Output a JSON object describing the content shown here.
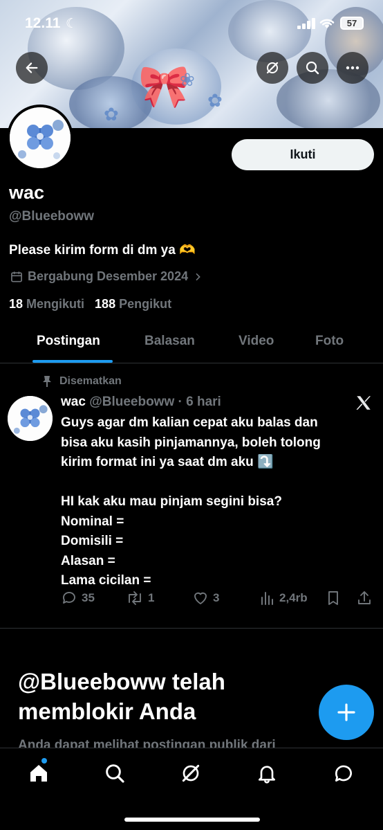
{
  "status_bar": {
    "time": "12.11",
    "battery": "57"
  },
  "profile": {
    "name": "wac",
    "handle": "@Blueeboww",
    "bio": "Please kirim form di dm ya 🫶",
    "joined": "Bergabung Desember 2024",
    "following_count": "18",
    "following_label": "Mengikuti",
    "followers_count": "188",
    "followers_label": "Pengikut",
    "follow_button": "Ikuti"
  },
  "tabs": [
    {
      "label": "Postingan",
      "active": true
    },
    {
      "label": "Balasan",
      "active": false
    },
    {
      "label": "Video",
      "active": false
    },
    {
      "label": "Foto",
      "active": false
    }
  ],
  "pinned_post": {
    "pinned_label": "Disematkan",
    "author_name": "wac",
    "author_meta": "@Blueeboww · 6 hari",
    "body_lines": [
      "Guys agar dm kalian cepat aku balas dan",
      "bisa aku kasih pinjamannya, boleh tolong",
      "kirim format ini ya saat dm aku ⤵️",
      "",
      "HI kak aku mau pinjam segini bisa?",
      "Nominal =",
      "Domisili =",
      "Alasan =",
      "Lama cicilan ="
    ],
    "replies": "35",
    "reposts": "1",
    "likes": "3",
    "views": "2,4rb"
  },
  "blocked": {
    "title": "@Blueeboww telah memblokir Anda",
    "subtitle": "Anda dapat melihat postingan publik dari"
  },
  "colors": {
    "accent": "#1d9bf0",
    "background": "#000000",
    "muted": "#71767b"
  },
  "icons": [
    "back-arrow-icon",
    "grok-icon",
    "search-icon",
    "more-icon",
    "calendar-icon",
    "chevron-right-icon",
    "pin-icon",
    "x-logo-icon",
    "reply-icon",
    "repost-icon",
    "like-icon",
    "views-icon",
    "bookmark-icon",
    "share-icon",
    "plus-icon",
    "home-icon",
    "bell-icon",
    "messages-icon"
  ]
}
